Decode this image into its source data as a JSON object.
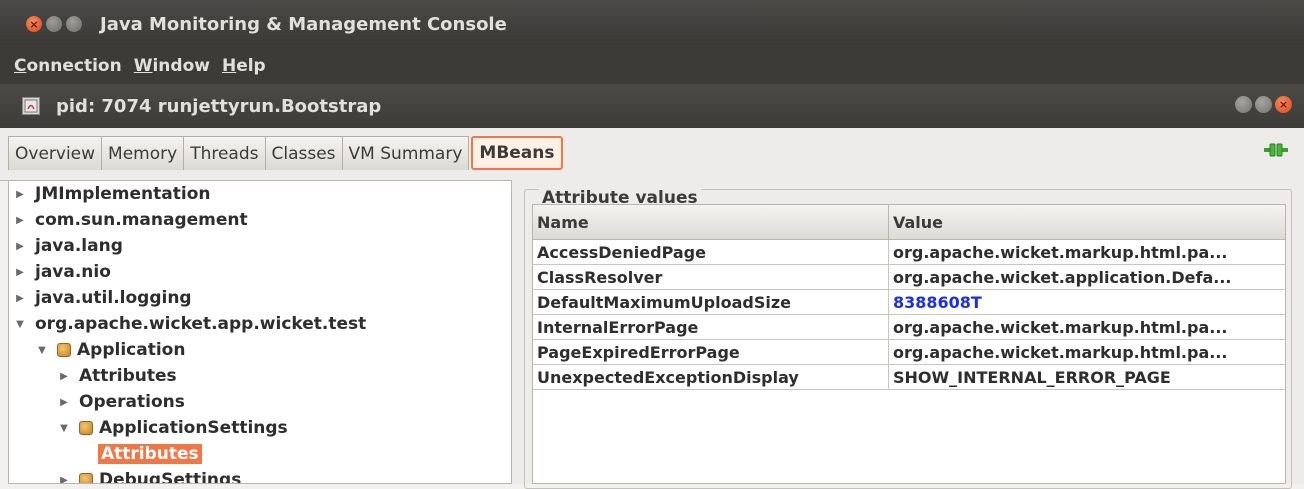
{
  "window": {
    "title": "Java Monitoring & Management Console",
    "buttons": {
      "close": "×",
      "minimize": "",
      "maximize": ""
    }
  },
  "menu": {
    "items": [
      {
        "label_u": "C",
        "label_rest": "onnection"
      },
      {
        "label_u": "W",
        "label_rest": "indow"
      },
      {
        "label_u": "H",
        "label_rest": "elp"
      }
    ]
  },
  "frame": {
    "title": "pid: 7074 runjettyrun.Bootstrap"
  },
  "tabs": [
    {
      "label": "Overview",
      "active": false
    },
    {
      "label": "Memory",
      "active": false
    },
    {
      "label": "Threads",
      "active": false
    },
    {
      "label": "Classes",
      "active": false
    },
    {
      "label": "VM Summary",
      "active": false
    },
    {
      "label": "MBeans",
      "active": true
    }
  ],
  "tree": [
    {
      "label": "JMImplementation",
      "indent": 0,
      "arrow": "▶",
      "bean": false,
      "selected": false
    },
    {
      "label": "com.sun.management",
      "indent": 0,
      "arrow": "▶",
      "bean": false,
      "selected": false
    },
    {
      "label": "java.lang",
      "indent": 0,
      "arrow": "▶",
      "bean": false,
      "selected": false
    },
    {
      "label": "java.nio",
      "indent": 0,
      "arrow": "▶",
      "bean": false,
      "selected": false
    },
    {
      "label": "java.util.logging",
      "indent": 0,
      "arrow": "▶",
      "bean": false,
      "selected": false
    },
    {
      "label": "org.apache.wicket.app.wicket.test",
      "indent": 0,
      "arrow": "▼",
      "bean": false,
      "selected": false
    },
    {
      "label": "Application",
      "indent": 1,
      "arrow": "▼",
      "bean": true,
      "selected": false
    },
    {
      "label": "Attributes",
      "indent": 2,
      "arrow": "▶",
      "bean": false,
      "selected": false
    },
    {
      "label": "Operations",
      "indent": 2,
      "arrow": "▶",
      "bean": false,
      "selected": false
    },
    {
      "label": "ApplicationSettings",
      "indent": 2,
      "arrow": "▼",
      "bean": true,
      "selected": false
    },
    {
      "label": "Attributes",
      "indent": 3,
      "arrow": "▶",
      "bean": false,
      "selected": true
    },
    {
      "label": "DebugSettings",
      "indent": 2,
      "arrow": "▶",
      "bean": true,
      "selected": false
    }
  ],
  "attributes": {
    "group_title": "Attribute values",
    "columns": {
      "name": "Name",
      "value": "Value"
    },
    "rows": [
      {
        "name": "AccessDeniedPage",
        "value": "org.apache.wicket.markup.html.pa...",
        "link": false
      },
      {
        "name": "ClassResolver",
        "value": "org.apache.wicket.application.Defa...",
        "link": false
      },
      {
        "name": "DefaultMaximumUploadSize",
        "value": "8388608T",
        "link": true
      },
      {
        "name": "InternalErrorPage",
        "value": "org.apache.wicket.markup.html.pa...",
        "link": false
      },
      {
        "name": "PageExpiredErrorPage",
        "value": "org.apache.wicket.markup.html.pa...",
        "link": false
      },
      {
        "name": "UnexpectedExceptionDisplay",
        "value": "SHOW_INTERNAL_ERROR_PAGE",
        "link": false
      }
    ]
  },
  "colors": {
    "accent": "#f07746",
    "link": "#1b30e6",
    "titlebar": "#3c3b37"
  }
}
